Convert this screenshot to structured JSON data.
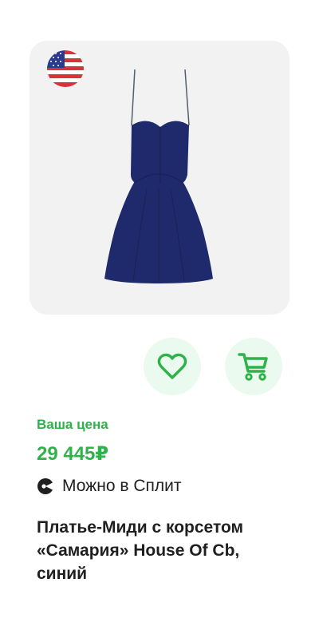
{
  "product": {
    "image_alt": "Платье-Миди с корсетом «Самария» House Of Cb, синий",
    "origin_flag": "usa-flag-icon",
    "title": "Платье-Миди с корсетом «Самария» House Of Cb, синий"
  },
  "actions": {
    "favorite_icon": "heart-icon",
    "cart_icon": "cart-icon"
  },
  "price": {
    "label": "Ваша цена",
    "value": "29 445₽"
  },
  "split": {
    "label": "Можно в Сплит",
    "icon": "split-icon"
  },
  "colors": {
    "accent_green": "#2fb24a",
    "button_bg": "#eafaee",
    "card_bg": "#f2f2f2",
    "dress_navy": "#1e2a6b"
  }
}
